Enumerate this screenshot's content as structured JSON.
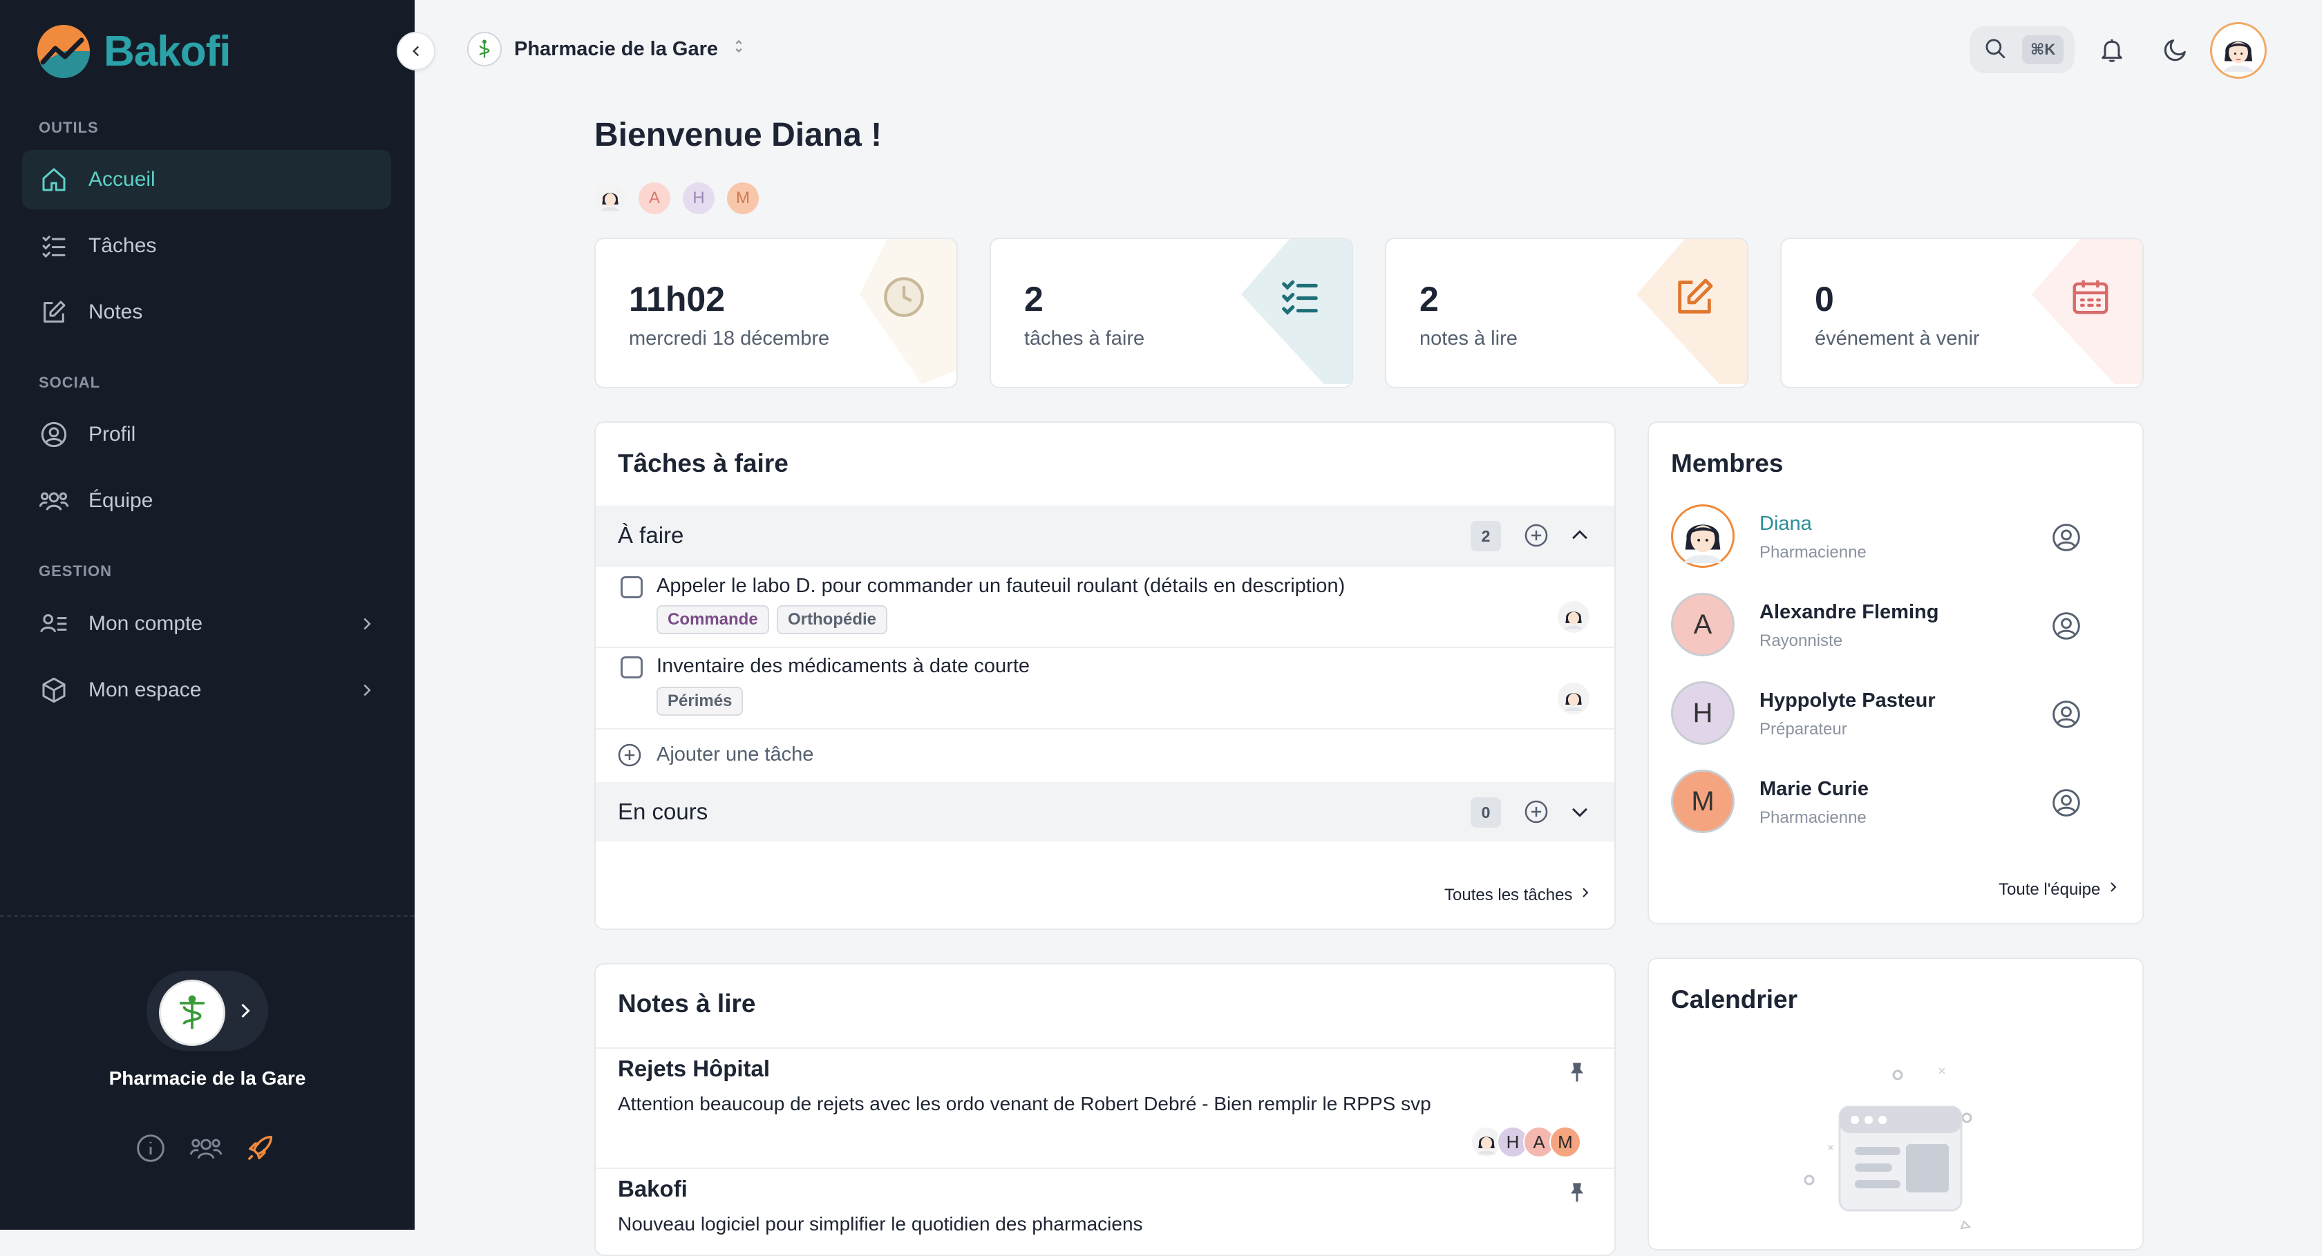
{
  "brand": {
    "name": "Bakofi"
  },
  "sidebar": {
    "sections": [
      {
        "label": "OUTILS"
      },
      {
        "label": "SOCIAL"
      },
      {
        "label": "GESTION"
      }
    ],
    "items": [
      {
        "label": "Accueil",
        "icon": "home-icon"
      },
      {
        "label": "Tâches",
        "icon": "checklist-icon"
      },
      {
        "label": "Notes",
        "icon": "edit-note-icon"
      },
      {
        "label": "Profil",
        "icon": "user-circle-icon"
      },
      {
        "label": "Équipe",
        "icon": "team-icon"
      },
      {
        "label": "Mon compte",
        "icon": "account-icon"
      },
      {
        "label": "Mon espace",
        "icon": "box-icon"
      }
    ],
    "pharmacy_name": "Pharmacie de la Gare"
  },
  "header": {
    "pharmacy": "Pharmacie de la Gare",
    "shortcut": "⌘K"
  },
  "welcome": {
    "title": "Bienvenue Diana !",
    "avatars": [
      "A",
      "H",
      "M"
    ]
  },
  "stats": [
    {
      "value": "11h02",
      "label": "mercredi 18 décembre"
    },
    {
      "value": "2",
      "label": "tâches à faire"
    },
    {
      "value": "2",
      "label": "notes à lire"
    },
    {
      "value": "0",
      "label": "événement à venir"
    }
  ],
  "tasks": {
    "title": "Tâches à faire",
    "groups": [
      {
        "label": "À faire",
        "count": "2"
      },
      {
        "label": "En cours",
        "count": "0"
      }
    ],
    "items": [
      {
        "text": "Appeler le labo D. pour commander un fauteuil roulant (détails en description)",
        "tags": [
          "Commande",
          "Orthopédie"
        ]
      },
      {
        "text": "Inventaire des médicaments à date courte",
        "tags": [
          "Périmés"
        ]
      }
    ],
    "add_label": "Ajouter une tâche",
    "all_link": "Toutes les tâches"
  },
  "members": {
    "title": "Membres",
    "list": [
      {
        "initial": "",
        "name": "Diana",
        "role": "Pharmacienne"
      },
      {
        "initial": "A",
        "name": "Alexandre Fleming",
        "role": "Rayonniste"
      },
      {
        "initial": "H",
        "name": "Hyppolyte Pasteur",
        "role": "Préparateur"
      },
      {
        "initial": "M",
        "name": "Marie Curie",
        "role": "Pharmacienne"
      }
    ],
    "all_link": "Toute l'équipe"
  },
  "notes": {
    "title": "Notes à lire",
    "items": [
      {
        "title": "Rejets Hôpital",
        "text": "Attention beaucoup de rejets avec les ordo venant de Robert Debré - Bien remplir le RPPS svp",
        "readers": [
          "H",
          "A",
          "M"
        ]
      },
      {
        "title": "Bakofi",
        "text": "Nouveau logiciel pour simplifier le quotidien des pharmaciens"
      }
    ]
  },
  "calendar": {
    "title": "Calendrier"
  },
  "colors": {
    "accent": "#2aa2a8",
    "sidebar_bg": "#161c27",
    "active_text": "#5fd0c6",
    "orange": "#f08a3c"
  }
}
